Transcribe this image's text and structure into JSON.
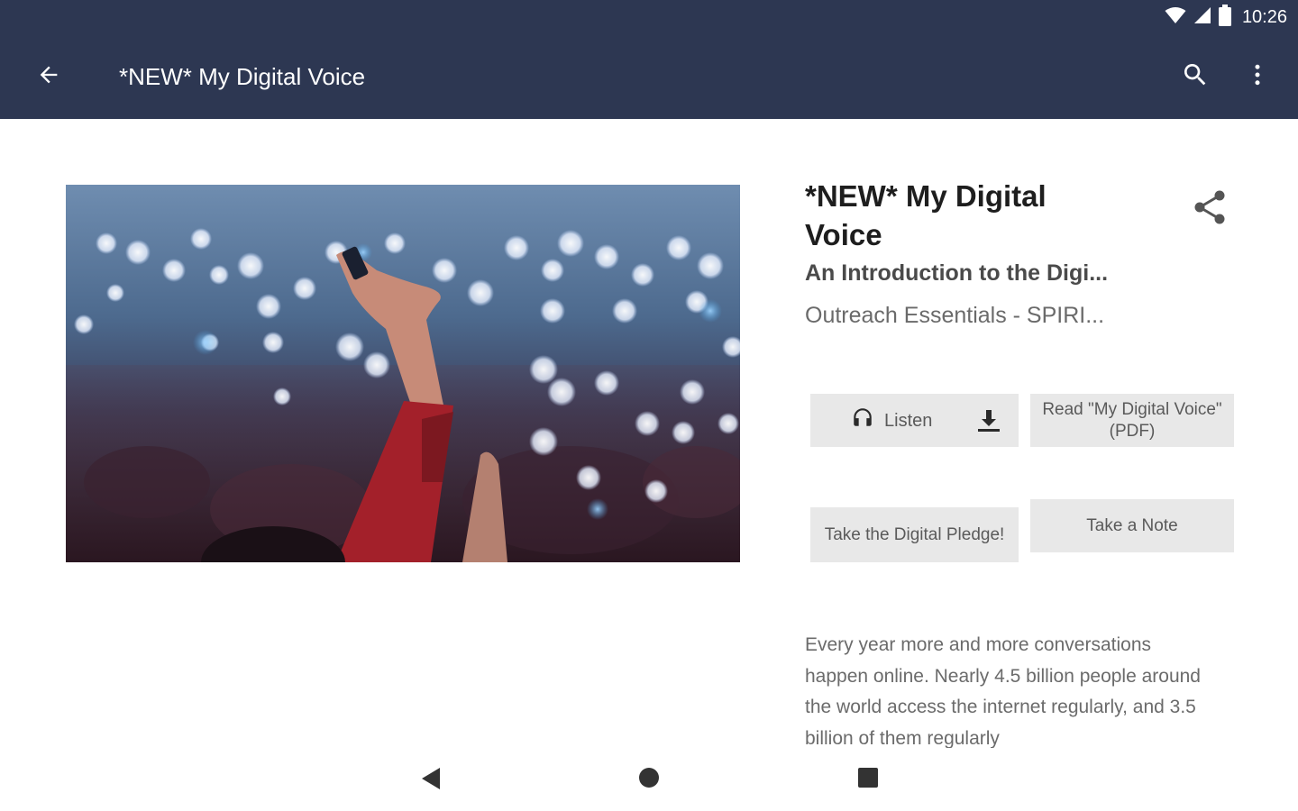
{
  "status_bar": {
    "time": "10:26",
    "icons": [
      "wifi-icon",
      "cell-signal-icon",
      "battery-icon"
    ]
  },
  "app_bar": {
    "title": "*NEW* My Digital Voice",
    "back_icon": "arrow-back-icon",
    "search_icon": "search-icon",
    "overflow_icon": "more-vert-icon",
    "background": "#2d3752"
  },
  "content": {
    "title": "*NEW* My Digital Voice",
    "subtitle": "An Introduction to the Digi...",
    "series": "Outreach Essentials - SPIRI...",
    "share_icon": "share-icon",
    "hero_image": "concert-crowd-phone-lights-image",
    "buttons": {
      "listen": "Listen",
      "read_pdf": "Read \"My Digital Voice\" (PDF)",
      "pledge": "Take the Digital Pledge!",
      "note": "Take a Note"
    },
    "description": "Every year more and more conversations happen online. Nearly 4.5 billion people around the world access the internet regularly, and 3.5 billion of them regularly"
  },
  "nav_bar": {
    "icons": [
      "nav-back-icon",
      "nav-home-icon",
      "nav-recents-icon"
    ]
  }
}
